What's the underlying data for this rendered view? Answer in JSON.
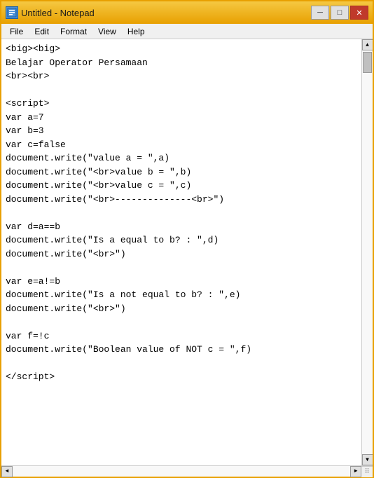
{
  "window": {
    "title": "Untitled - Notepad",
    "icon_char": "📄"
  },
  "title_buttons": {
    "minimize": "─",
    "restore": "□",
    "close": "✕"
  },
  "menu": {
    "items": [
      "File",
      "Edit",
      "Format",
      "View",
      "Help"
    ]
  },
  "editor": {
    "content": "<big><big>\nBelajar Operator Persamaan\n<br><br>\n\n<script>\nvar a=7\nvar b=3\nvar c=false\ndocument.write(\"value a = \",a)\ndocument.write(\"<br>value b = \",b)\ndocument.write(\"<br>value c = \",c)\ndocument.write(\"<br>--------------<br>\")\n\nvar d=a==b\ndocument.write(\"Is a equal to b? : \",d)\ndocument.write(\"<br>\")\n\nvar e=a!=b\ndocument.write(\"Is a not equal to b? : \",e)\ndocument.write(\"<br>\")\n\nvar f=!c\ndocument.write(\"Boolean value of NOT c = \",f)\n\n</script>"
  },
  "scrollbar": {
    "up_arrow": "▲",
    "down_arrow": "▼",
    "left_arrow": "◄",
    "right_arrow": "►"
  }
}
